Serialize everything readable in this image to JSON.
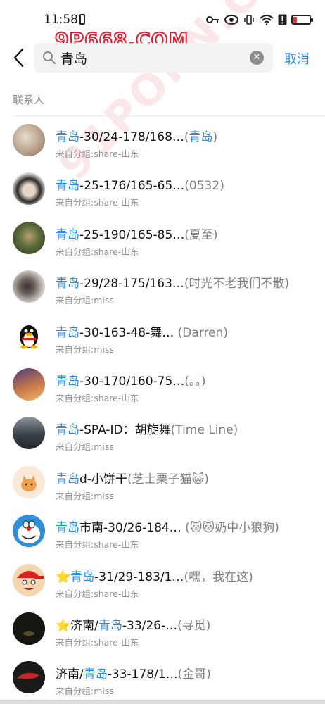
{
  "status_bar": {
    "time": "11:58"
  },
  "watermark": {
    "top_text": "9P668.COM",
    "diagonal_text": "91PORN.COM"
  },
  "header": {
    "search_value": "青岛",
    "cancel_label": "取消"
  },
  "section": {
    "label": "联系人"
  },
  "contacts": [
    {
      "pre": "",
      "hl": "青岛",
      "post": "-30/24-178/168…",
      "remark": "(",
      "remark_hl": "青岛",
      "remark_post": ")",
      "group": "来自分组:share-山东",
      "avatar": "avatar-sparkle",
      "avatar_color": "#c9b9a8"
    },
    {
      "pre": "",
      "hl": "青岛",
      "post": "-25-176/165-65…",
      "remark": "(0532)",
      "remark_hl": "",
      "remark_post": "",
      "group": "来自分组:share-山东",
      "avatar": "avatar-woman-dark-hair",
      "avatar_color": "#d8d2cc"
    },
    {
      "pre": "",
      "hl": "青岛",
      "post": "-25-190/165-85…",
      "remark": "(夏至)",
      "remark_hl": "",
      "remark_post": "",
      "group": "来自分组:share-山东",
      "avatar": "avatar-forest",
      "avatar_color": "#4a5a3a"
    },
    {
      "pre": "",
      "hl": "青岛",
      "post": "-29/28-175/163…",
      "remark": "(时光不老我们不散)",
      "remark_hl": "",
      "remark_post": "",
      "group": "来自分组:miss",
      "avatar": "avatar-girl-selfie",
      "avatar_color": "#c7c2bd"
    },
    {
      "pre": "",
      "hl": "青岛",
      "post": "-30-163-48-舞…",
      "remark": " (Darren)",
      "remark_hl": "",
      "remark_post": "",
      "group": "来自分组:miss",
      "avatar": "qq-penguin-icon",
      "avatar_color": "#ffffff"
    },
    {
      "pre": "",
      "hl": "青岛",
      "post": "-30-170/160-75…",
      "remark": "(。。)",
      "remark_hl": "",
      "remark_post": "",
      "group": "来自分组:share-山东",
      "avatar": "avatar-sunset-illustration",
      "avatar_color": "#7a5a8a"
    },
    {
      "pre": "",
      "hl": "青岛",
      "post": "-SPA-ID：胡旋舞",
      "remark": "(Time Line)",
      "remark_hl": "",
      "remark_post": "",
      "group": "来自分组:miss",
      "avatar": "avatar-street",
      "avatar_color": "#55606a"
    },
    {
      "pre": "",
      "hl": "青岛",
      "post": "d-小饼干",
      "remark": "(芝士栗子猫😺)",
      "remark_hl": "",
      "remark_post": "",
      "group": "来自分组:miss",
      "avatar": "avatar-cat-cartoon",
      "avatar_color": "#fbe9d8"
    },
    {
      "pre": "",
      "hl": "青岛",
      "post": "市南-30/26-184…",
      "remark": " (🐱🐱奶中小狼狗)",
      "remark_hl": "",
      "remark_post": "",
      "group": "来自分组:share-山东",
      "avatar": "avatar-doraemon",
      "avatar_color": "#2f8fd8"
    },
    {
      "pre": "⭐",
      "hl": "青岛",
      "post": "-31/29-183/1…",
      "remark": "(嘿，我在这)",
      "remark_hl": "",
      "remark_post": "",
      "group": "来自分组:share-山东",
      "avatar": "avatar-cartoon-cap-boy",
      "avatar_color": "#f4d6b0"
    },
    {
      "pre": "⭐济南/",
      "hl": "青岛",
      "post": "-33/26-…",
      "remark": "(寻觅)",
      "remark_hl": "",
      "remark_post": "",
      "group": "来自分组:share-山东",
      "avatar": "avatar-dark-night",
      "avatar_color": "#151512"
    },
    {
      "pre": "济南/",
      "hl": "青岛",
      "post": "-33-178/1…",
      "remark": "(金哥)",
      "remark_hl": "",
      "remark_post": "",
      "group": "来自分组:miss",
      "avatar": "avatar-red-fish",
      "avatar_color": "#1a1a1a"
    }
  ],
  "colors": {
    "accent": "#2a8ae6",
    "remark": "#7d7d7d",
    "group": "#8f8f8f"
  }
}
